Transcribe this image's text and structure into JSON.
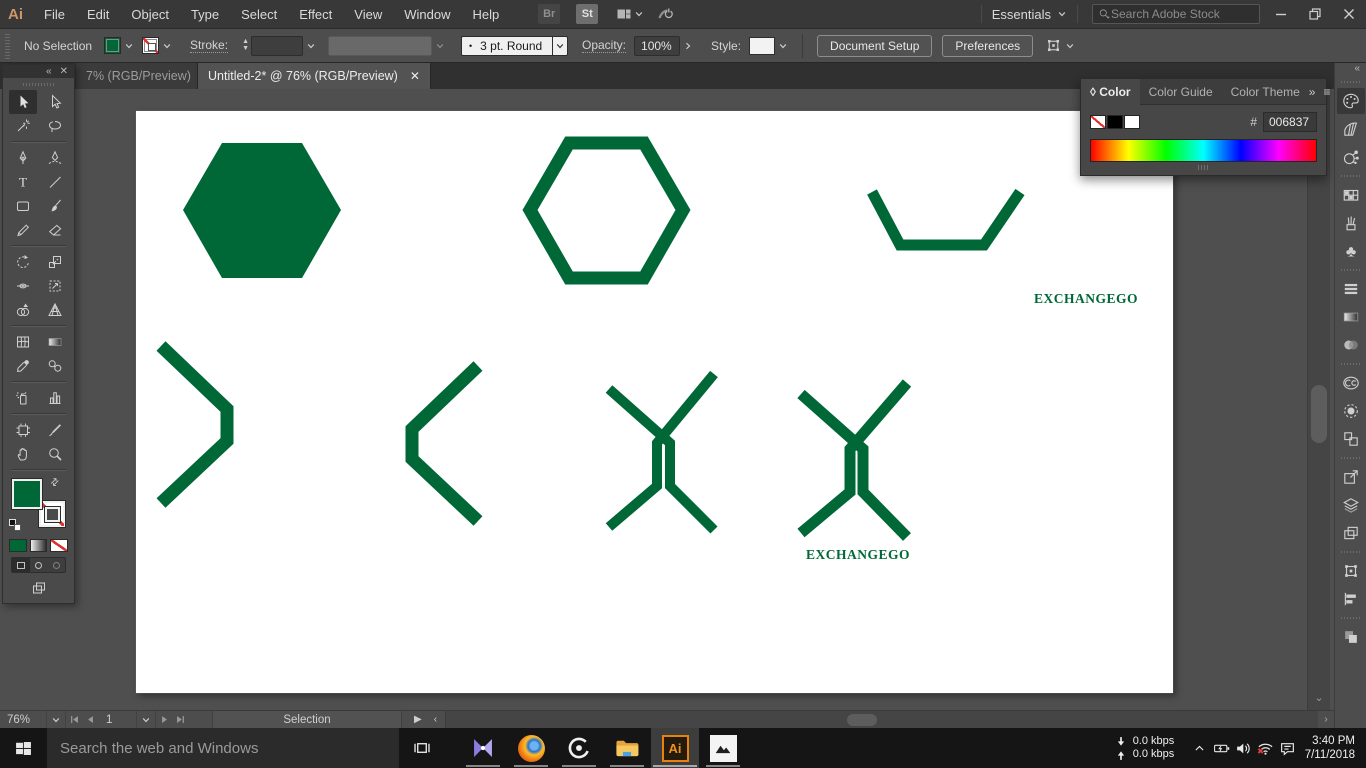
{
  "menubar": {
    "app_logo": "Ai",
    "items": [
      "File",
      "Edit",
      "Object",
      "Type",
      "Select",
      "Effect",
      "View",
      "Window",
      "Help"
    ],
    "bridge_label": "Br",
    "stock_label": "St",
    "workspace_name": "Essentials",
    "stock_search_placeholder": "Search Adobe Stock"
  },
  "controlbar": {
    "selection_status": "No Selection",
    "stroke_label": "Stroke:",
    "brush_preset": "3 pt. Round",
    "opacity_label": "Opacity:",
    "opacity_value": "100%",
    "style_label": "Style:",
    "document_setup_label": "Document Setup",
    "preferences_label": "Preferences"
  },
  "tabbar": {
    "tabs": [
      {
        "label": "7% (RGB/Preview)",
        "active": false
      },
      {
        "label": "Untitled-2* @ 76% (RGB/Preview)",
        "active": true
      }
    ]
  },
  "toolbar": {
    "active_tool": "selection-tool",
    "fill_color": "#006837",
    "groups": [
      [
        "selection-tool",
        "direct-selection-tool",
        "magic-wand-tool",
        "lasso-tool"
      ],
      [
        "pen-tool",
        "curvature-tool",
        "type-tool",
        "line-segment-tool",
        "rectangle-tool",
        "paintbrush-tool",
        "pencil-tool",
        "eraser-tool"
      ],
      [
        "rotate-tool",
        "scale-tool",
        "width-tool",
        "free-transform-tool",
        "shape-builder-tool",
        "perspective-grid-tool"
      ],
      [
        "mesh-tool",
        "gradient-tool",
        "eyedropper-tool",
        "blend-tool"
      ],
      [
        "symbol-sprayer-tool",
        "column-graph-tool"
      ],
      [
        "artboard-tool",
        "slice-tool",
        "hand-tool",
        "zoom-tool"
      ]
    ]
  },
  "color_panel": {
    "tabs": [
      "Color",
      "Color Guide",
      "Color Theme"
    ],
    "active_tab": "Color",
    "hex_label": "#",
    "hex_value": "006837"
  },
  "right_strip": {
    "active_panel": "color-panel",
    "groups": [
      [
        "color-panel",
        "color-guide-panel",
        "color-themes-panel"
      ],
      [
        "swatches-panel",
        "brushes-panel",
        "symbols-panel"
      ],
      [
        "stroke-panel",
        "gradient-panel",
        "transparency-panel"
      ],
      [
        "cc-libraries-panel",
        "adobe-color-panel",
        "asset-export-panel"
      ],
      [
        "artboards-panel",
        "layers-panel",
        "pages-panel"
      ],
      [
        "transform-panel",
        "align-panel"
      ],
      [
        "pathfinder-panel"
      ]
    ]
  },
  "canvas": {
    "logo_text": "EXCHANGEGO",
    "logo_color": "#006837"
  },
  "statusbar": {
    "zoom_level": "76%",
    "artboard_number": "1",
    "status_text": "Selection"
  },
  "taskbar": {
    "search_placeholder": "Search the web and Windows",
    "apps": [
      "kmplayer",
      "firefox",
      "recorder",
      "file-explorer",
      "illustrator",
      "photos"
    ],
    "active_app": "illustrator",
    "open_apps": [
      "kmplayer",
      "firefox",
      "recorder",
      "file-explorer",
      "illustrator",
      "photos"
    ],
    "tray": {
      "download_speed": "0.0 kbps",
      "upload_speed": "0.0 kbps",
      "time": "3:40 PM",
      "date": "7/11/2018"
    }
  }
}
